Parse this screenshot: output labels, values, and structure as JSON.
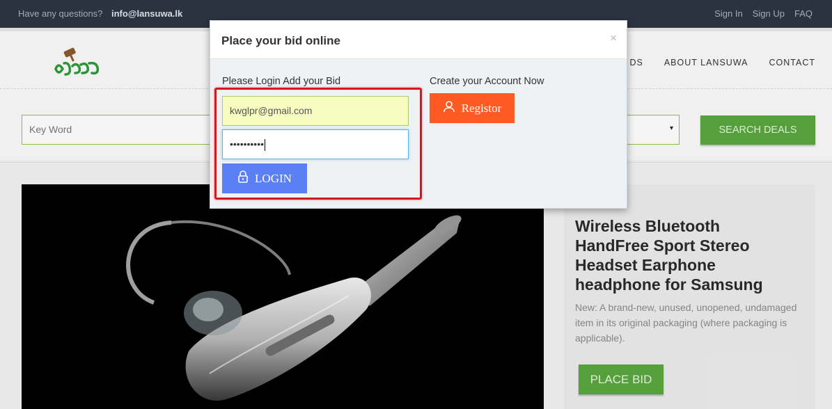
{
  "topbar": {
    "question": "Have any questions?",
    "email": "info@lansuwa.lk",
    "links": [
      "Sign In",
      "Sign Up",
      "FAQ"
    ]
  },
  "nav": {
    "items": [
      "DS",
      "ABOUT LANSUWA",
      "CONTACT"
    ]
  },
  "search": {
    "keyword_placeholder": "Key Word",
    "button_label": "SEARCH DEALS",
    "category_arrow": "▾"
  },
  "product": {
    "title": "Wireless Bluetooth HandFree Sport Stereo Headset Earphone headphone for Samsung",
    "description": "New: A brand-new, unused, unopened, undamaged item in its original packaging (where packaging is applicable).",
    "bid_button": "PLACE BID"
  },
  "modal": {
    "title": "Place your bid online",
    "close": "×",
    "login_label": "Please Login Add your Bid",
    "email_value": "kwglpr@gmail.com",
    "password_mask": "••••••••••",
    "login_button": "LOGIN",
    "create_label": "Create your Account Now",
    "register_button": "Registor"
  },
  "colors": {
    "topbar": "#2d3643",
    "green": "#5aa73f",
    "login_blue": "#5b7ff5",
    "register_orange": "#ff5a22",
    "highlight_red": "#d9161d"
  }
}
